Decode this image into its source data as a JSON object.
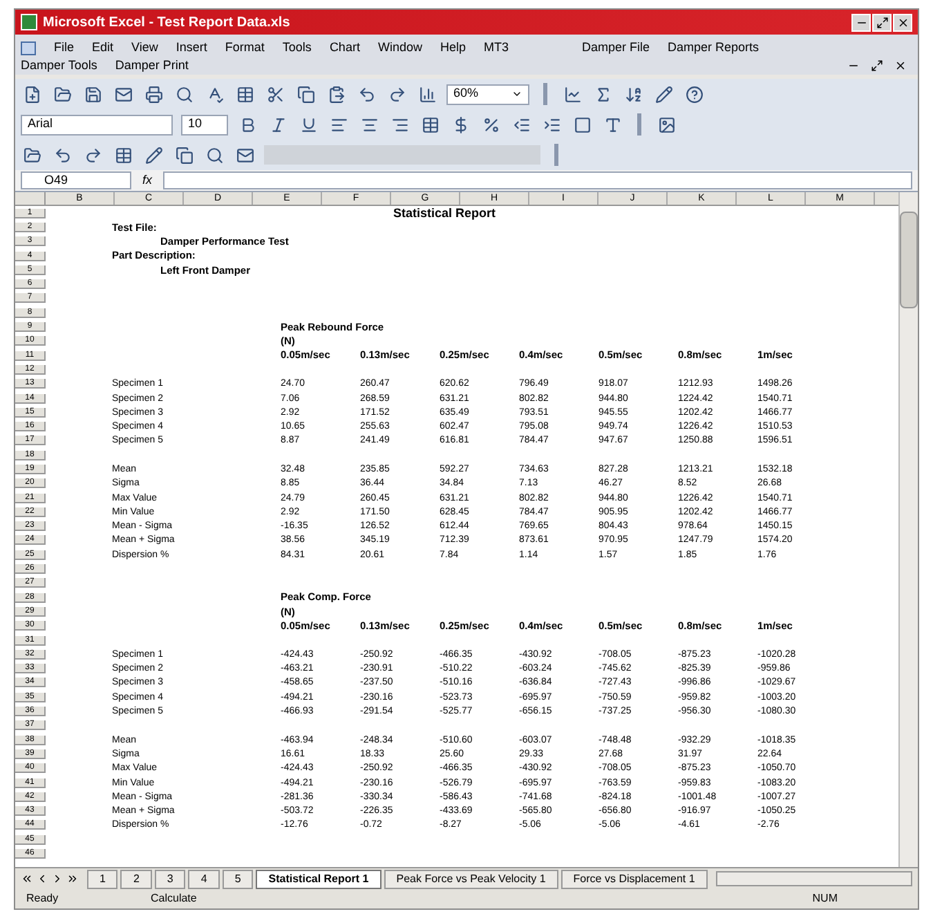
{
  "window": {
    "title": "Microsoft Excel - Test Report Data.xls"
  },
  "menu_rows": [
    [
      "File",
      "Edit",
      "View",
      "Insert",
      "Format",
      "Tools",
      "Chart",
      "Window",
      "Help",
      "MT3",
      "Damper File",
      "Damper Reports"
    ],
    [
      "Damper Tools",
      "Damper Print"
    ]
  ],
  "toolbar": {
    "zoom": "60%",
    "font": "Arial",
    "font_size": "10"
  },
  "formula_bar": {
    "name_box": "O49",
    "fx": "fx"
  },
  "columns": [
    "B",
    "C",
    "D",
    "E",
    "F",
    "G",
    "H",
    "I",
    "J",
    "K",
    "L",
    "M"
  ],
  "rows": [
    {
      "number": "1",
      "kind": "title",
      "title": "Statistical Report"
    },
    {
      "number": "2",
      "kind": "label",
      "text": "Test File:"
    },
    {
      "number": "3",
      "kind": "sublabel",
      "text": "Damper Performance Test"
    },
    {
      "number": "4",
      "kind": "label",
      "text": "Part Description:"
    },
    {
      "number": "5",
      "kind": "sublabel",
      "text": "Left Front Damper"
    },
    {
      "number": "6",
      "kind": "blank"
    },
    {
      "number": "7",
      "kind": "blank"
    },
    {
      "number": "8",
      "kind": "blank"
    },
    {
      "number": "9",
      "kind": "heading",
      "text": "Peak Rebound Force"
    },
    {
      "number": "10",
      "kind": "heading",
      "text": "(N)"
    },
    {
      "number": "11",
      "kind": "header",
      "cells": [
        "0.05m/sec",
        "0.13m/sec",
        "0.25m/sec",
        "0.4m/sec",
        "0.5m/sec",
        "0.8m/sec",
        "1m/sec"
      ]
    },
    {
      "number": "12",
      "kind": "blank"
    },
    {
      "number": "13",
      "kind": "data",
      "label": "Specimen 1",
      "cells": [
        "24.70",
        "260.47",
        "620.62",
        "796.49",
        "918.07",
        "1212.93",
        "1498.26"
      ]
    },
    {
      "number": "14",
      "kind": "data",
      "label": "Specimen 2",
      "cells": [
        "7.06",
        "268.59",
        "631.21",
        "802.82",
        "944.80",
        "1224.42",
        "1540.71"
      ]
    },
    {
      "number": "15",
      "kind": "data",
      "label": "Specimen 3",
      "cells": [
        "2.92",
        "171.52",
        "635.49",
        "793.51",
        "945.55",
        "1202.42",
        "1466.77"
      ]
    },
    {
      "number": "16",
      "kind": "data",
      "label": "Specimen 4",
      "cells": [
        "10.65",
        "255.63",
        "602.47",
        "795.08",
        "949.74",
        "1226.42",
        "1510.53"
      ]
    },
    {
      "number": "17",
      "kind": "data",
      "label": "Specimen 5",
      "cells": [
        "8.87",
        "241.49",
        "616.81",
        "784.47",
        "947.67",
        "1250.88",
        "1596.51"
      ]
    },
    {
      "number": "18",
      "kind": "blank"
    },
    {
      "number": "19",
      "kind": "data",
      "label": "Mean",
      "cells": [
        "32.48",
        "235.85",
        "592.27",
        "734.63",
        "827.28",
        "1213.21",
        "1532.18"
      ]
    },
    {
      "number": "20",
      "kind": "data",
      "label": "Sigma",
      "cells": [
        "8.85",
        "36.44",
        "34.84",
        "7.13",
        "46.27",
        "8.52",
        "26.68"
      ]
    },
    {
      "number": "21",
      "kind": "data",
      "label": "Max Value",
      "cells": [
        "24.79",
        "260.45",
        "631.21",
        "802.82",
        "944.80",
        "1226.42",
        "1540.71"
      ]
    },
    {
      "number": "22",
      "kind": "data",
      "label": "Min Value",
      "cells": [
        "2.92",
        "171.50",
        "628.45",
        "784.47",
        "905.95",
        "1202.42",
        "1466.77"
      ]
    },
    {
      "number": "23",
      "kind": "data",
      "label": "Mean - Sigma",
      "cells": [
        "-16.35",
        "126.52",
        "612.44",
        "769.65",
        "804.43",
        "978.64",
        "1450.15"
      ]
    },
    {
      "number": "24",
      "kind": "data",
      "label": "Mean + Sigma",
      "cells": [
        "38.56",
        "345.19",
        "712.39",
        "873.61",
        "970.95",
        "1247.79",
        "1574.20"
      ]
    },
    {
      "number": "25",
      "kind": "data",
      "label": "Dispersion %",
      "cells": [
        "84.31",
        "20.61",
        "7.84",
        "1.14",
        "1.57",
        "1.85",
        "1.76"
      ]
    },
    {
      "number": "26",
      "kind": "blank"
    },
    {
      "number": "27",
      "kind": "blank"
    },
    {
      "number": "28",
      "kind": "heading",
      "text": "Peak Comp. Force"
    },
    {
      "number": "29",
      "kind": "heading",
      "text": "(N)"
    },
    {
      "number": "30",
      "kind": "header",
      "cells": [
        "0.05m/sec",
        "0.13m/sec",
        "0.25m/sec",
        "0.4m/sec",
        "0.5m/sec",
        "0.8m/sec",
        "1m/sec"
      ]
    },
    {
      "number": "31",
      "kind": "blank"
    },
    {
      "number": "32",
      "kind": "data",
      "label": "Specimen 1",
      "cells": [
        "-424.43",
        "-250.92",
        "-466.35",
        "-430.92",
        "-708.05",
        "-875.23",
        "-1020.28"
      ]
    },
    {
      "number": "33",
      "kind": "data",
      "label": "Specimen 2",
      "cells": [
        "-463.21",
        "-230.91",
        "-510.22",
        "-603.24",
        "-745.62",
        "-825.39",
        "-959.86"
      ]
    },
    {
      "number": "34",
      "kind": "data",
      "label": "Specimen 3",
      "cells": [
        "-458.65",
        "-237.50",
        "-510.16",
        "-636.84",
        "-727.43",
        "-996.86",
        "-1029.67"
      ]
    },
    {
      "number": "35",
      "kind": "data",
      "label": "Specimen 4",
      "cells": [
        "-494.21",
        "-230.16",
        "-523.73",
        "-695.97",
        "-750.59",
        "-959.82",
        "-1003.20"
      ]
    },
    {
      "number": "36",
      "kind": "data",
      "label": "Specimen 5",
      "cells": [
        "-466.93",
        "-291.54",
        "-525.77",
        "-656.15",
        "-737.25",
        "-956.30",
        "-1080.30"
      ]
    },
    {
      "number": "37",
      "kind": "blank"
    },
    {
      "number": "38",
      "kind": "data",
      "label": "Mean",
      "cells": [
        "-463.94",
        "-248.34",
        "-510.60",
        "-603.07",
        "-748.48",
        "-932.29",
        "-1018.35"
      ]
    },
    {
      "number": "39",
      "kind": "data",
      "label": "Sigma",
      "cells": [
        "16.61",
        "18.33",
        "25.60",
        "29.33",
        "27.68",
        "31.97",
        "22.64"
      ]
    },
    {
      "number": "40",
      "kind": "data",
      "label": "Max Value",
      "cells": [
        "-424.43",
        "-250.92",
        "-466.35",
        "-430.92",
        "-708.05",
        "-875.23",
        "-1050.70"
      ]
    },
    {
      "number": "41",
      "kind": "data",
      "label": "Min Value",
      "cells": [
        "-494.21",
        "-230.16",
        "-526.79",
        "-695.97",
        "-763.59",
        "-959.83",
        "-1083.20"
      ]
    },
    {
      "number": "42",
      "kind": "data",
      "label": "Mean - Sigma",
      "cells": [
        "-281.36",
        "-330.34",
        "-586.43",
        "-741.68",
        "-824.18",
        "-1001.48",
        "-1007.27"
      ]
    },
    {
      "number": "43",
      "kind": "data",
      "label": "Mean + Sigma",
      "cells": [
        "-503.72",
        "-226.35",
        "-433.69",
        "-565.80",
        "-656.80",
        "-916.97",
        "-1050.25"
      ]
    },
    {
      "number": "44",
      "kind": "data",
      "label": "Dispersion %",
      "cells": [
        "-12.76",
        "-0.72",
        "-8.27",
        "-5.06",
        "-5.06",
        "-4.61",
        "-2.76"
      ]
    },
    {
      "number": "45",
      "kind": "blank"
    },
    {
      "number": "46",
      "kind": "blank"
    }
  ],
  "sheet_tabs": [
    {
      "label": "1",
      "selected": false
    },
    {
      "label": "2",
      "selected": false
    },
    {
      "label": "3",
      "selected": false
    },
    {
      "label": "4",
      "selected": false
    },
    {
      "label": "5",
      "selected": false
    },
    {
      "label": "Statistical Report 1",
      "selected": true
    },
    {
      "label": "Peak Force vs Peak Velocity 1",
      "selected": false
    },
    {
      "label": "Force vs Displacement 1",
      "selected": false
    }
  ],
  "status_bar": {
    "left": "Ready",
    "middle": "Calculate",
    "right": "NUM"
  }
}
